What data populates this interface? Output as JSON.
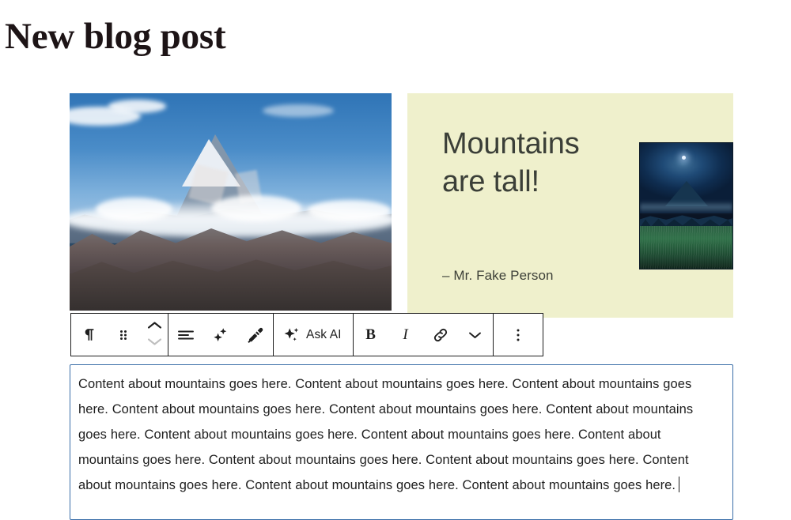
{
  "page": {
    "title": "New blog post"
  },
  "media": {
    "mountain_photo": {
      "alt": "Snow-capped mountain peak above clouds against a blue sky"
    },
    "night_photo": {
      "alt": "Night landscape with a volcano silhouette, moon and grassy field"
    }
  },
  "quote": {
    "text": "Mountains are tall!",
    "attribution": "– Mr. Fake Person",
    "background_color": "#eff0cc",
    "text_color": "#3b3f38"
  },
  "toolbar": {
    "block_type_label": "paragraph-block-type",
    "drag_label": "drag-handle",
    "move_up_label": "move-up",
    "move_down_label": "move-down",
    "align_label": "align-text",
    "sparkle_label": "sparkle",
    "brush_label": "style-brush",
    "ask_ai_label": "Ask AI",
    "bold_label": "B",
    "italic_label": "I",
    "link_label": "link",
    "more_formats_label": "more-formatting",
    "options_label": "options"
  },
  "editor": {
    "paragraph_text": "Content about mountains goes here. Content about mountains goes here. Content about mountains goes here. Content about mountains goes here. Content about mountains goes here. Content about mountains goes here. Content about mountains goes here. Content about mountains goes here. Content about mountains goes here. Content about mountains goes here. Content about mountains goes here. Content about mountains goes here. Content about mountains goes here. Content about mountains goes here.",
    "selected": true,
    "selection_border_color": "#3a6ea8",
    "caret_visible": true
  }
}
